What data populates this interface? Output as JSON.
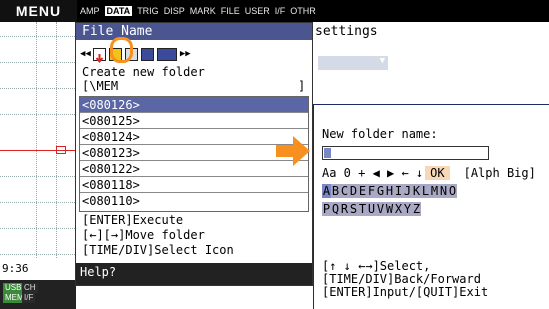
{
  "left_panel": {
    "menu_label": "MENU",
    "time_text": "9:36",
    "badges": [
      "USB",
      "CH",
      "MEM",
      "I/F"
    ]
  },
  "tabs": [
    "AMP",
    "DATA",
    "TRIG",
    "DISP",
    "MARK",
    "FILE",
    "USER",
    "I/F",
    "OTHR"
  ],
  "active_tab": "DATA",
  "settings_label": "settings",
  "dialog": {
    "title": "File Name",
    "create_label": "Create new folder",
    "path": "[\\MEM",
    "path_end": "]",
    "folders": [
      "<080126>",
      "<080125>",
      "<080124>",
      "<080123>",
      "<080122>",
      "<080118>",
      "<080110>"
    ],
    "selected_index": 0,
    "hints": [
      "[ENTER]Execute",
      "[←][→]Move folder",
      "[TIME/DIV]Select Icon"
    ],
    "help": "Help?"
  },
  "popup": {
    "label": "New folder name:",
    "mode_chars": "Aa 0 + ◀ ▶ ← ↓",
    "ok_label": "OK",
    "mode_label": "[Alph Big]",
    "row1": [
      "A",
      "B",
      "C",
      "D",
      "E",
      "F",
      "G",
      "H",
      "I",
      "J",
      "K",
      "L",
      "M",
      "N",
      "O"
    ],
    "row2": [
      "P",
      "Q",
      "R",
      "S",
      "T",
      "U",
      "V",
      "W",
      "X",
      "Y",
      "Z"
    ],
    "nav": [
      "[↑ ↓ ←→]Select,",
      "[TIME/DIV]Back/Forward",
      "[ENTER]Input/[QUIT]Exit"
    ]
  },
  "colors": {
    "title_bar": "#4b5690",
    "selected_row": "#5b66a4",
    "highlight_ring": "#f7901e",
    "arrow": "#f7901e"
  }
}
